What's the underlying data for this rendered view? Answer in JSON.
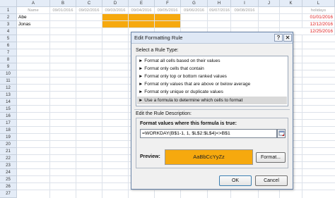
{
  "sheet": {
    "columns": [
      "A",
      "B",
      "C",
      "D",
      "E",
      "F",
      "G",
      "H",
      "I",
      "J",
      "K",
      "L"
    ],
    "rows": [
      "1",
      "2",
      "3",
      "4",
      "5",
      "6",
      "7",
      "8",
      "9",
      "10",
      "11",
      "12",
      "13",
      "14",
      "15",
      "16",
      "17",
      "18",
      "19",
      "20",
      "21",
      "22",
      "23",
      "24",
      "25",
      "26",
      "27"
    ],
    "row1": [
      "Name",
      "09/01/2016",
      "09/02/2016",
      "09/03/2016",
      "09/04/2016",
      "09/05/2016",
      "09/06/2016",
      "09/07/2016",
      "09/08/2016",
      "",
      "",
      "holidays"
    ],
    "names": [
      "Abe",
      "Jonas"
    ],
    "holidays": [
      "01/01/2016",
      "12/12/2016",
      "12/25/2016"
    ],
    "colors": {
      "highlight": "#f6a90e",
      "holiday_text": "#e02020",
      "date_text": "#9a9a9a"
    }
  },
  "dialog": {
    "title": "Edit Formatting Rule",
    "help_button": "?",
    "close_button": "✕",
    "select_rule_type_label": "Select a Rule Type:",
    "rule_types": [
      "► Format all cells based on their values",
      "► Format only cells that contain",
      "► Format only top or bottom ranked values",
      "► Format only values that are above or below average",
      "► Format only unique or duplicate values",
      "► Use a formula to determine which cells to format"
    ],
    "selected_rule_index": 5,
    "edit_description_label": "Edit the Rule Description:",
    "formula_label": "Format values where this formula is true:",
    "formula_value": "=WORKDAY(B$1-1, 1, $L$2:$L$4)<>B$1",
    "preview_label": "Preview:",
    "preview_sample": "AaBbCcYyZz",
    "format_button": "Format...",
    "ok_button": "OK",
    "cancel_button": "Cancel"
  }
}
